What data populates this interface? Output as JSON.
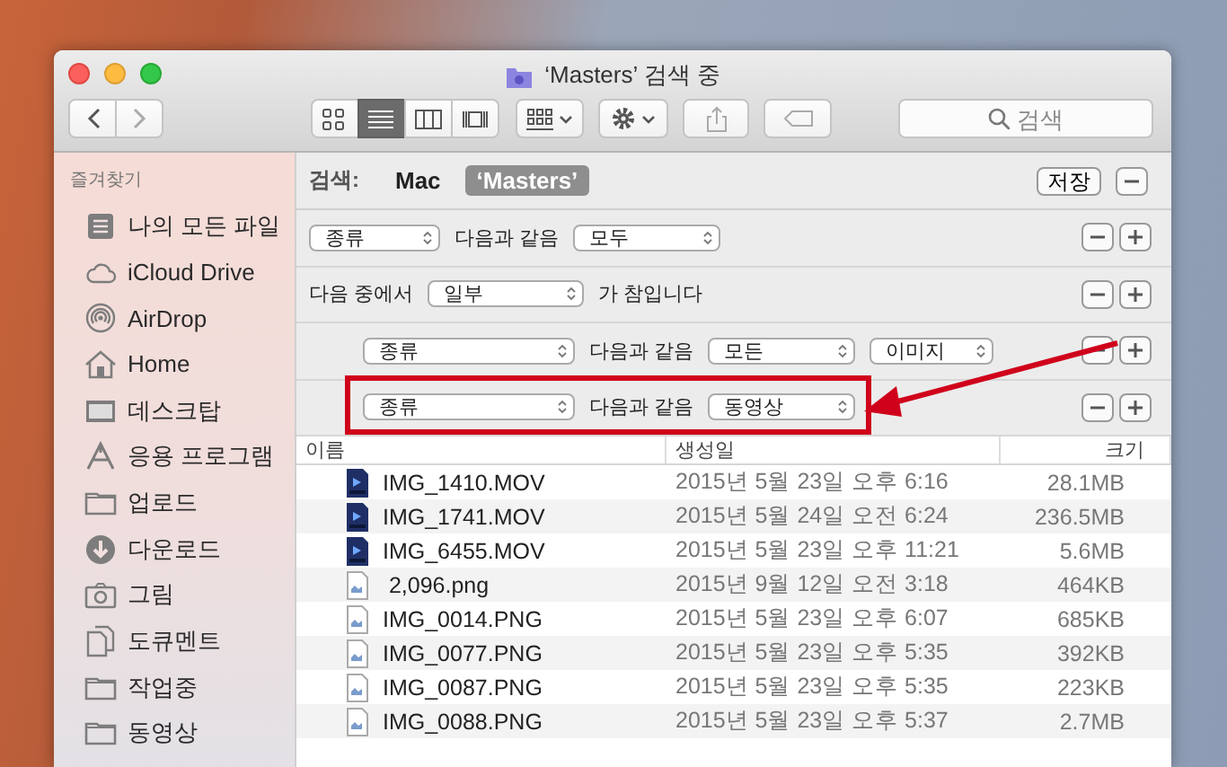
{
  "window": {
    "title": "‘Masters’ 검색 중"
  },
  "toolbar": {
    "view_modes": [
      {
        "selected": false
      },
      {
        "selected": true
      },
      {
        "selected": false
      },
      {
        "selected": false
      }
    ],
    "search": {
      "placeholder": "검색"
    }
  },
  "sidebar": {
    "heading": "즐겨찾기",
    "items": [
      {
        "label": "나의 모든 파일"
      },
      {
        "label": "iCloud Drive"
      },
      {
        "label": "AirDrop"
      },
      {
        "label": "Home"
      },
      {
        "label": "데스크탑"
      },
      {
        "label": "응용 프로그램"
      },
      {
        "label": "업로드"
      },
      {
        "label": "다운로드"
      },
      {
        "label": "그림"
      },
      {
        "label": "도큐멘트"
      },
      {
        "label": "작업중"
      },
      {
        "label": "동영상"
      }
    ]
  },
  "search_bar": {
    "label": "검색:",
    "scopes": [
      {
        "label": "Mac",
        "selected": false
      },
      {
        "label": "‘Masters’",
        "selected": true
      }
    ],
    "save_button": "저장"
  },
  "criteria": [
    {
      "kind": "condition",
      "attribute": "종류",
      "operator": "다음과 같음",
      "values": [
        "모두"
      ],
      "highlighted": false
    },
    {
      "kind": "group",
      "prefix": "다음 중에서",
      "quantifier": "일부",
      "suffix": "가 참입니다",
      "children": [
        {
          "kind": "condition",
          "attribute": "종류",
          "operator": "다음과 같음",
          "values": [
            "모든",
            "이미지"
          ],
          "highlighted": false
        },
        {
          "kind": "condition",
          "attribute": "종류",
          "operator": "다음과 같음",
          "values": [
            "동영상"
          ],
          "highlighted": true
        }
      ]
    }
  ],
  "table": {
    "columns": [
      "이름",
      "생성일",
      "크기"
    ],
    "rows": [
      {
        "kind": "movie",
        "name": "IMG_1410.MOV",
        "created": "2015년 5월 23일 오후 6:16",
        "size": "28.1MB"
      },
      {
        "kind": "movie",
        "name": "IMG_1741.MOV",
        "created": "2015년 5월 24일 오전 6:24",
        "size": "236.5MB"
      },
      {
        "kind": "movie",
        "name": "IMG_6455.MOV",
        "created": "2015년 5월 23일 오후 11:21",
        "size": "5.6MB"
      },
      {
        "kind": "image",
        "name": " 2,096.png",
        "created": "2015년 9월 12일 오전 3:18",
        "size": "464KB"
      },
      {
        "kind": "image",
        "name": "IMG_0014.PNG",
        "created": "2015년 5월 23일 오후 6:07",
        "size": "685KB"
      },
      {
        "kind": "image",
        "name": "IMG_0077.PNG",
        "created": "2015년 5월 23일 오후 5:35",
        "size": "392KB"
      },
      {
        "kind": "image",
        "name": "IMG_0087.PNG",
        "created": "2015년 5월 23일 오후 5:35",
        "size": "223KB"
      },
      {
        "kind": "image",
        "name": "IMG_0088.PNG",
        "created": "2015년 5월 23일 오후 5:37",
        "size": "2.7MB"
      }
    ]
  }
}
